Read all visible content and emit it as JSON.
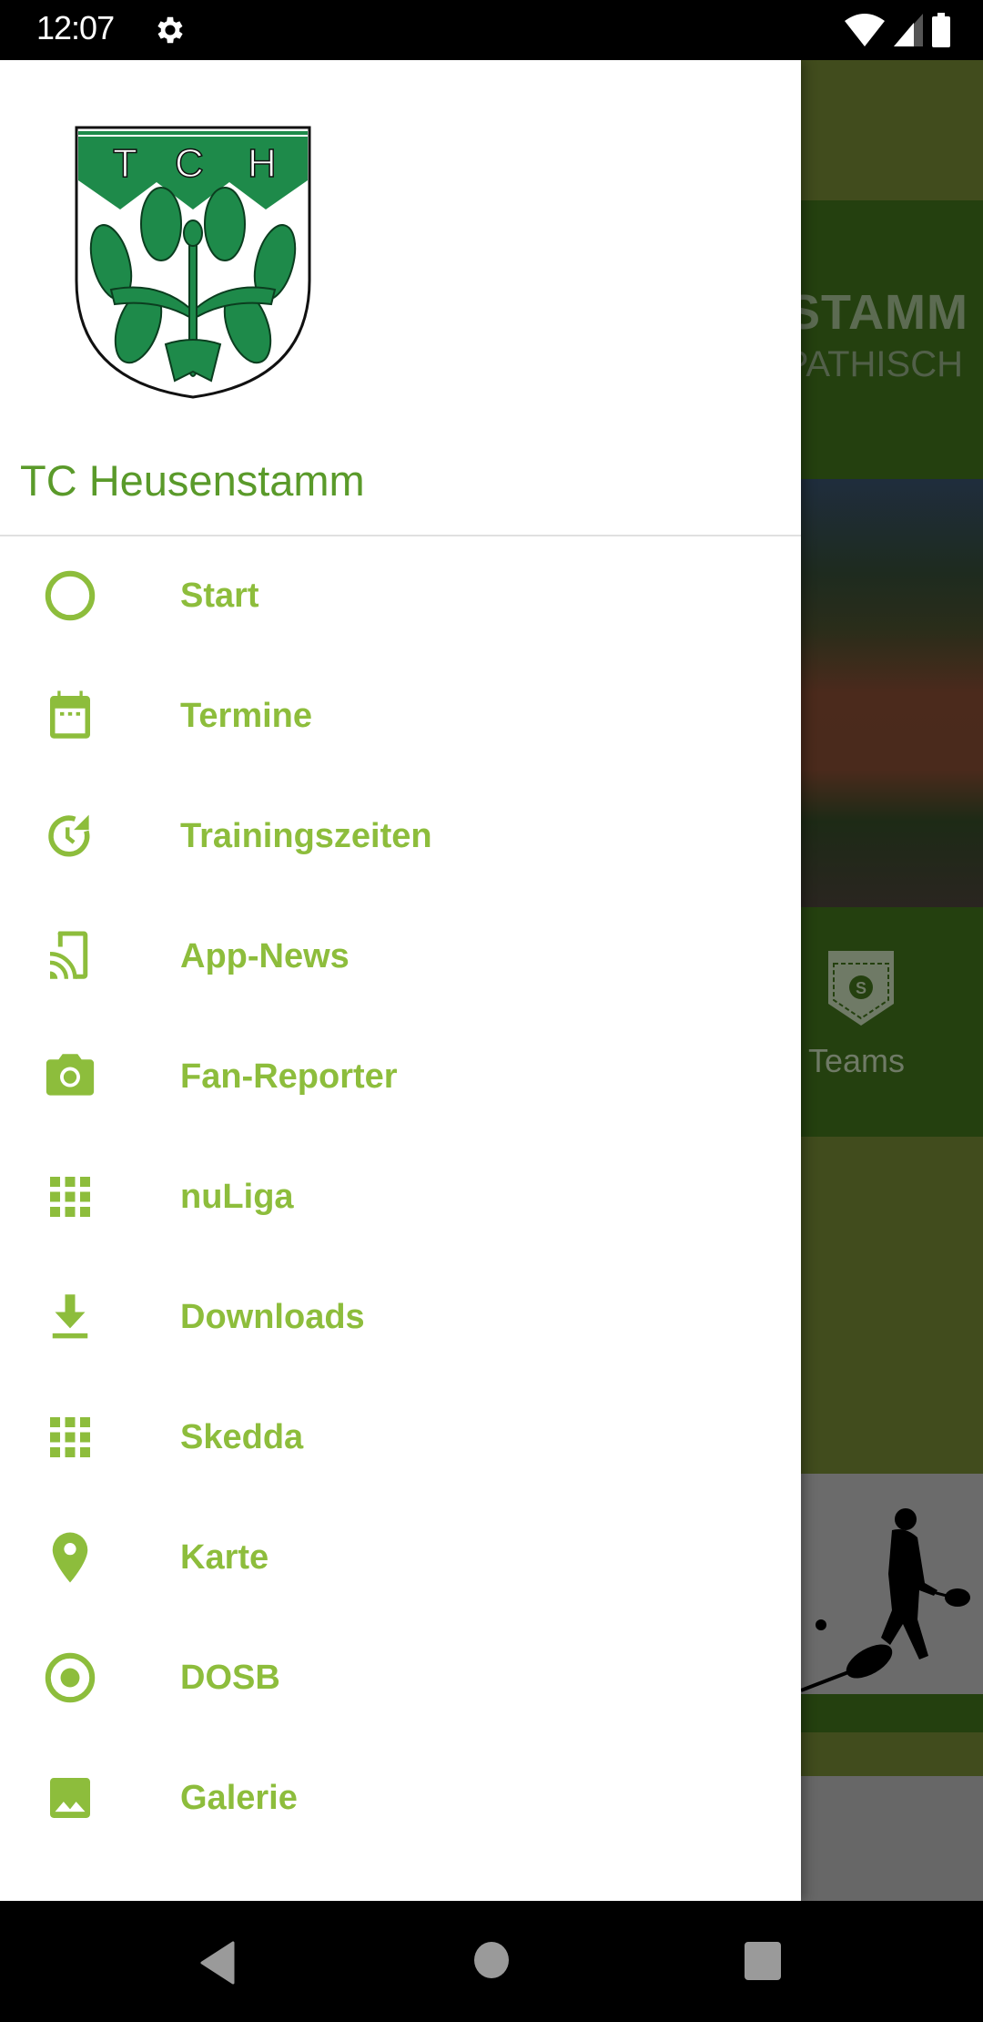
{
  "status_bar": {
    "time": "12:07",
    "icons": [
      "gear-icon",
      "wifi-icon",
      "cell-signal-icon",
      "battery-icon"
    ]
  },
  "background_app": {
    "banner_line1": "STAMM",
    "banner_line2": "PATHISCH",
    "teams_label": "Teams",
    "teams_icon": "badge-icon"
  },
  "drawer": {
    "club_name": "TC Heusenstamm",
    "logo_letters": [
      "T",
      "C",
      "H"
    ],
    "accent_color": "#8dbd3c",
    "title_color": "#5a9a2a",
    "items": [
      {
        "label": "Start",
        "icon": "circle-outline-icon"
      },
      {
        "label": "Termine",
        "icon": "calendar-icon"
      },
      {
        "label": "Trainingszeiten",
        "icon": "clock-refresh-icon"
      },
      {
        "label": "App-News",
        "icon": "cast-icon"
      },
      {
        "label": "Fan-Reporter",
        "icon": "camera-icon"
      },
      {
        "label": "nuLiga",
        "icon": "grid-icon"
      },
      {
        "label": "Downloads",
        "icon": "download-icon"
      },
      {
        "label": "Skedda",
        "icon": "grid-icon"
      },
      {
        "label": "Karte",
        "icon": "map-pin-icon"
      },
      {
        "label": "DOSB",
        "icon": "radio-button-icon"
      },
      {
        "label": "Galerie",
        "icon": "image-icon"
      }
    ]
  },
  "nav_bar": {
    "buttons": [
      "back",
      "home",
      "recents"
    ]
  }
}
